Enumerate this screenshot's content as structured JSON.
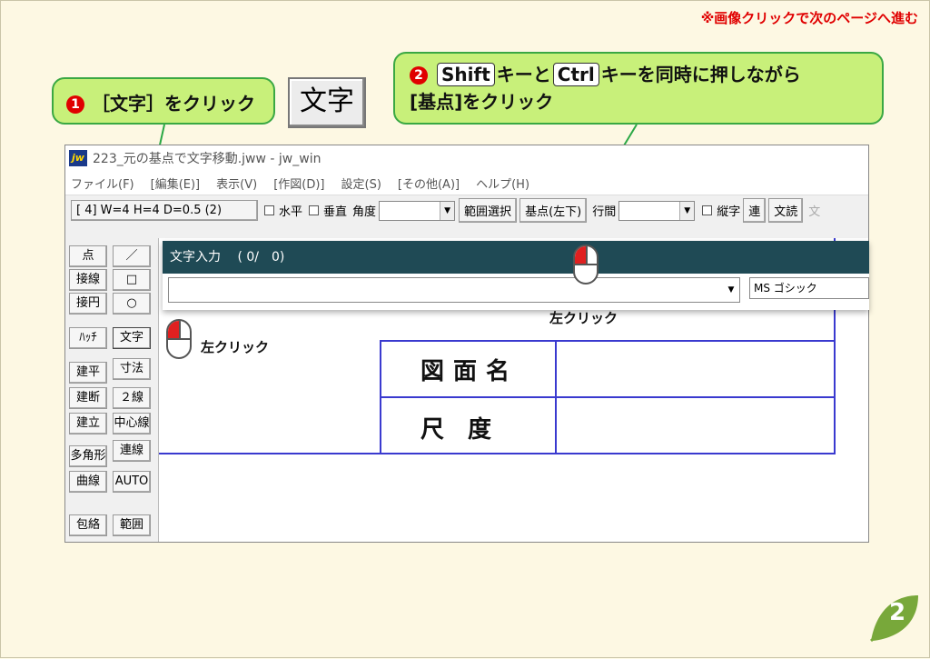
{
  "header_note": "※画像クリックで次のページへ進む",
  "callout1": {
    "num": "1",
    "text": "［文字］をクリック"
  },
  "callout2": {
    "num": "2",
    "key_shift": "Shift",
    "mid1": "キーと",
    "key_ctrl": "Ctrl",
    "mid2": "キーを同時に押しながら",
    "line2": "[基点]をクリック"
  },
  "big_button": "文字",
  "window": {
    "title": "223_元の基点で文字移動.jww - jw_win",
    "menu": [
      "ファイル(F)",
      "[編集(E)]",
      "表示(V)",
      "[作図(D)]",
      "設定(S)",
      "[その他(A)]",
      "ヘルプ(H)"
    ]
  },
  "toolbar": {
    "size_button": "[ 4] W=4 H=4 D=0.5 (2)",
    "horizontal": "水平",
    "vertical": "垂直",
    "angle": "角度",
    "range_select": "範囲選択",
    "base_point": "基点(左下)",
    "line_spacing": "行間",
    "vertical_text": "縦字",
    "ren": "連",
    "read": "文読",
    "more": "文"
  },
  "left_tools": {
    "col1": [
      "点",
      "接線",
      "接円",
      "ﾊｯﾁ",
      "建平",
      "建断",
      "建立",
      "多角形",
      "曲線",
      "包絡"
    ],
    "col2": [
      "／",
      "□",
      "○",
      "文字",
      "寸法",
      "２線",
      "中心線",
      "連線",
      "AUTO",
      "範囲"
    ]
  },
  "dialog": {
    "title": "文字入力　 ( 0/　0)",
    "font": "MS ゴシック"
  },
  "table": {
    "row1": "図面名",
    "row2": "尺　度"
  },
  "click_left_label": "左クリック",
  "click_top_label": "左クリック",
  "page_number": "2",
  "colors": {
    "callout_bg": "#c8f07a",
    "callout_border": "#3aa843",
    "accent_red": "#e00000",
    "dialog_title": "#1f4a55",
    "table_line": "#3a3acf",
    "leaf": "#78a83a"
  }
}
